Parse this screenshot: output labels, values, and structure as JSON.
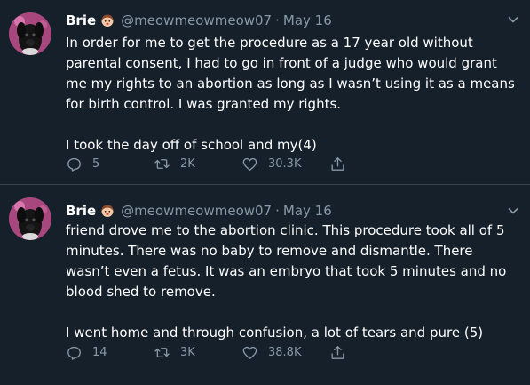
{
  "tweets": [
    {
      "author_name": "Brie",
      "author_emoji": "person-face-emoji",
      "handle": "@meowmeowmeow07",
      "separator": "·",
      "date": "May 16",
      "paragraphs": [
        "In order for me to get the procedure as a 17 year old without parental consent, I had to go in front of a judge who would grant me my rights to an abortion as long as I wasn’t using it as a means for birth control. I was granted my rights.",
        "I took the day off of school and my(4)"
      ],
      "replies": "5",
      "retweets": "2K",
      "likes": "30.3K"
    },
    {
      "author_name": "Brie",
      "author_emoji": "person-face-emoji",
      "handle": "@meowmeowmeow07",
      "separator": "·",
      "date": "May 16",
      "paragraphs": [
        "friend drove me to the abortion clinic. This procedure took all of 5 minutes. There was no baby to remove and dismantle. There wasn’t even a fetus. It was an embryo that took 5 minutes and no blood shed to remove.",
        "I went home and through confusion, a lot of tears and pure (5)"
      ],
      "replies": "14",
      "retweets": "3K",
      "likes": "38.8K"
    }
  ],
  "icons": {
    "reply": "reply-icon",
    "retweet": "retweet-icon",
    "like": "like-icon",
    "share": "share-icon",
    "caret": "chevron-down-icon"
  },
  "colors": {
    "background": "#15202b",
    "secondary_text": "#8899a6",
    "divider": "#38444d"
  }
}
